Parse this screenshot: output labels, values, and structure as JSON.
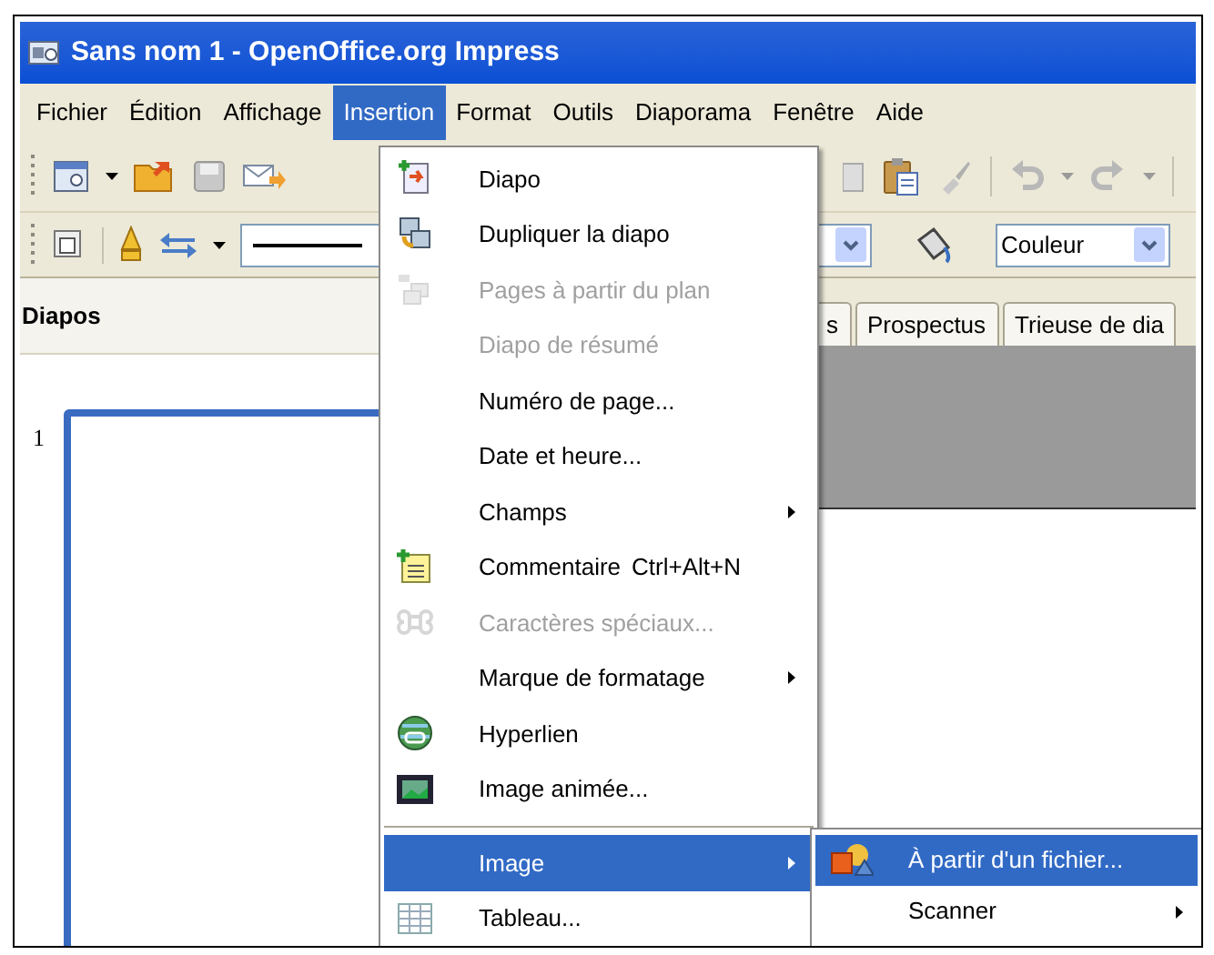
{
  "window": {
    "title": "Sans nom 1 - OpenOffice.org Impress"
  },
  "menu_bar": [
    {
      "label": "Fichier",
      "selected": false
    },
    {
      "label": "Édition",
      "selected": false
    },
    {
      "label": "Affichage",
      "selected": false
    },
    {
      "label": "Insertion",
      "selected": true
    },
    {
      "label": "Format",
      "selected": false
    },
    {
      "label": "Outils",
      "selected": false
    },
    {
      "label": "Diaporama",
      "selected": false
    },
    {
      "label": "Fenêtre",
      "selected": false
    },
    {
      "label": "Aide",
      "selected": false
    }
  ],
  "color_field": {
    "value": "Couleur"
  },
  "slides_panel": {
    "title": "Diapos",
    "slides": [
      {
        "number": "1",
        "selected": true
      }
    ]
  },
  "view_tabs": [
    {
      "label": "s",
      "selected": false
    },
    {
      "label": "Prospectus",
      "selected": false
    },
    {
      "label": "Trieuse de dia",
      "selected": false
    }
  ],
  "insert_menu": [
    {
      "kind": "item",
      "label": "Diapo",
      "disabled": false,
      "submenu": false,
      "selected": false
    },
    {
      "kind": "item",
      "label": "Dupliquer la diapo",
      "disabled": false,
      "submenu": false,
      "selected": false
    },
    {
      "kind": "item",
      "label": "Pages à partir du plan",
      "disabled": true,
      "submenu": false,
      "selected": false
    },
    {
      "kind": "item",
      "label": "Diapo de résumé",
      "disabled": true,
      "submenu": false,
      "selected": false
    },
    {
      "kind": "item",
      "label": "Numéro de page...",
      "disabled": false,
      "submenu": false,
      "selected": false
    },
    {
      "kind": "item",
      "label": "Date et heure...",
      "disabled": false,
      "submenu": false,
      "selected": false
    },
    {
      "kind": "item",
      "label": "Champs",
      "disabled": false,
      "submenu": true,
      "selected": false
    },
    {
      "kind": "item",
      "label": "Commentaire",
      "shortcut": "Ctrl+Alt+N",
      "disabled": false,
      "submenu": false,
      "selected": false
    },
    {
      "kind": "item",
      "label": "Caractères spéciaux...",
      "disabled": true,
      "submenu": false,
      "selected": false
    },
    {
      "kind": "item",
      "label": "Marque de formatage",
      "disabled": false,
      "submenu": true,
      "selected": false
    },
    {
      "kind": "item",
      "label": "Hyperlien",
      "disabled": false,
      "submenu": false,
      "selected": false
    },
    {
      "kind": "item",
      "label": "Image animée...",
      "disabled": false,
      "submenu": false,
      "selected": false
    },
    {
      "kind": "separator"
    },
    {
      "kind": "item",
      "label": "Image",
      "disabled": false,
      "submenu": true,
      "selected": true
    },
    {
      "kind": "item",
      "label": "Tableau...",
      "disabled": false,
      "submenu": false,
      "selected": false
    }
  ],
  "image_submenu": [
    {
      "label": "À partir d'un fichier...",
      "submenu": false,
      "selected": true
    },
    {
      "label": "Scanner",
      "submenu": true,
      "selected": false
    }
  ]
}
